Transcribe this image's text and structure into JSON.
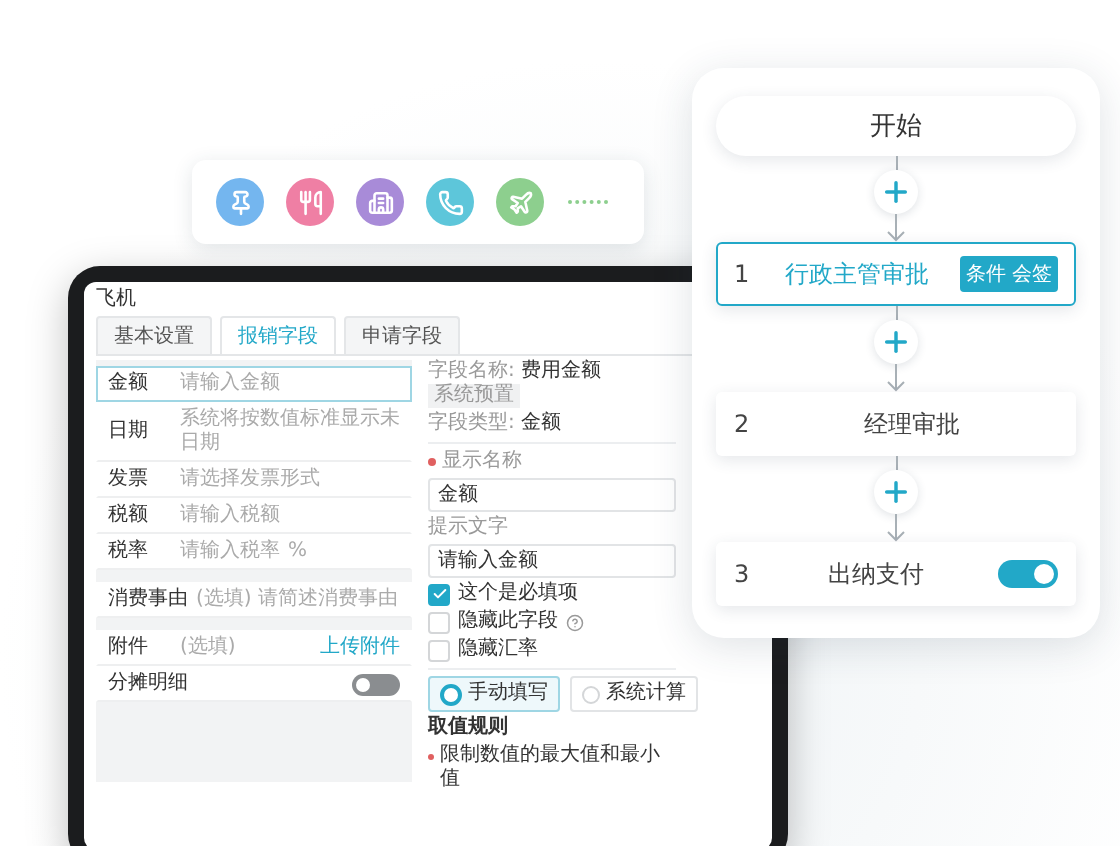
{
  "icon_bar": {
    "items": [
      {
        "color": "#74b6ef"
      },
      {
        "color": "#ef7fa4"
      },
      {
        "color": "#a88bd8"
      },
      {
        "color": "#5dc6da"
      },
      {
        "color": "#8dcf8e"
      }
    ]
  },
  "flow": {
    "start": "开始",
    "steps": [
      {
        "number": "1",
        "label": "行政主管审批",
        "selected": true,
        "tag": "条件 会签"
      },
      {
        "number": "2",
        "label": "经理审批",
        "selected": false
      },
      {
        "number": "3",
        "label": "出纳支付",
        "selected": false,
        "toggle": {
          "on": true
        }
      }
    ]
  },
  "tablet": {
    "title": "飞机",
    "tabs": [
      {
        "label": "基本设置",
        "selected": false
      },
      {
        "label": "报销字段",
        "selected": true
      },
      {
        "label": "申请字段",
        "selected": false
      }
    ],
    "groups": [
      {
        "rows": [
          {
            "kind": "field",
            "label": "金额",
            "placeholder": "请输入金额",
            "selected": true
          },
          {
            "kind": "field",
            "label": "日期",
            "placeholder": "系统将按数值标准显示未日期",
            "selected": false
          },
          {
            "kind": "field",
            "label": "发票",
            "placeholder": "请选择发票形式",
            "selected": false
          },
          {
            "kind": "field",
            "label": "税额",
            "placeholder": "请输入税额",
            "selected": false
          },
          {
            "kind": "field",
            "label": "税率",
            "placeholder": "请输入税率",
            "suffix": "%",
            "selected": false
          }
        ]
      },
      {
        "rows": [
          {
            "kind": "field",
            "label": "消费事由",
            "placeholder": "(选填) 请简述消费事由",
            "selected": false
          }
        ]
      },
      {
        "rows": [
          {
            "kind": "upload",
            "label": "附件",
            "note": "(选填)",
            "action": "上传附件"
          },
          {
            "kind": "toggle",
            "label": "分摊明细",
            "on": false
          }
        ]
      }
    ],
    "info": [
      {
        "label": "字段名称:",
        "value": "费用金额",
        "tag": "系统预置"
      },
      {
        "label": "字段类型:",
        "value": "金额"
      }
    ],
    "fields": [
      {
        "label": "显示名称",
        "required": true,
        "value": "金额"
      },
      {
        "label": "提示文字",
        "required": false,
        "value": "请输入金额"
      }
    ],
    "checks": [
      {
        "label": "这个是必填项",
        "checked": true,
        "help": false
      },
      {
        "label": "隐藏此字段",
        "checked": false,
        "help": true
      },
      {
        "label": "隐藏汇率",
        "checked": false,
        "help": false
      }
    ],
    "modes": [
      {
        "label": "手动填写",
        "selected": true
      },
      {
        "label": "系统计算",
        "selected": false
      }
    ],
    "rules": {
      "title": "取值规则",
      "items": [
        "限制数值的最大值和最小值"
      ]
    }
  }
}
